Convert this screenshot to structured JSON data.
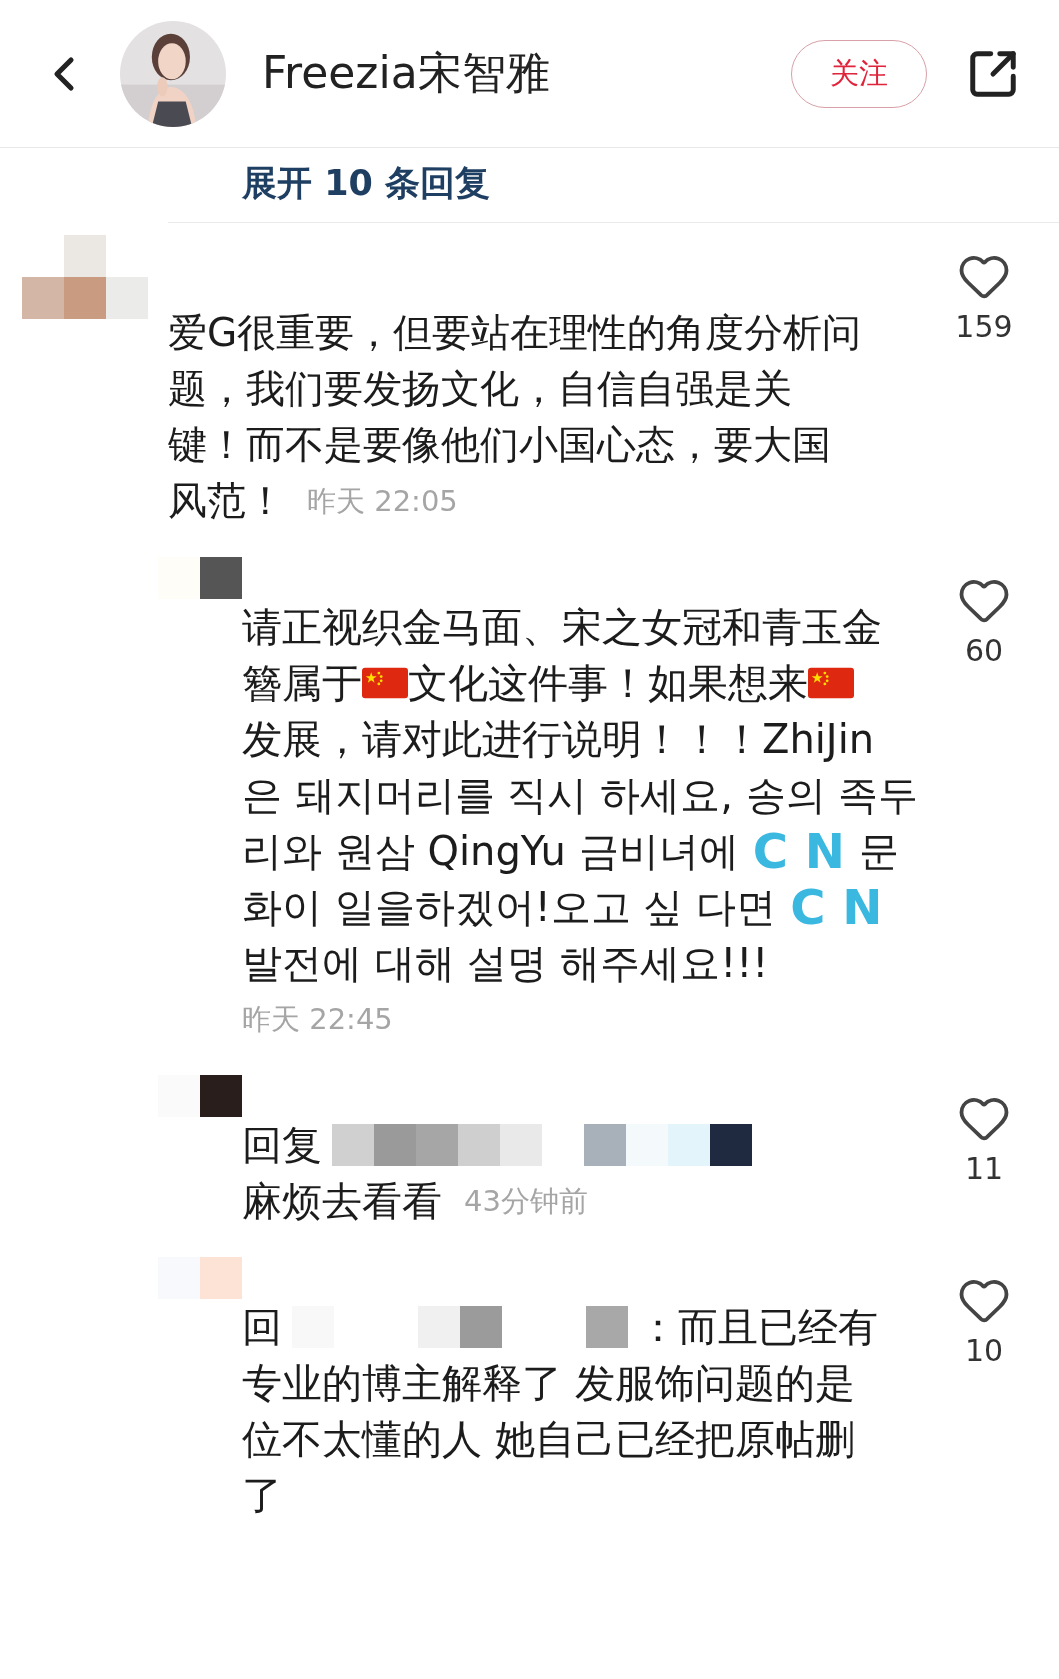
{
  "header": {
    "name": "Freezia宋智雅",
    "follow_button": "关注"
  },
  "expand_replies": "展开 10 条回复",
  "comments": [
    {
      "kind": "top",
      "likes": "159",
      "lines": [
        [
          {
            "kind": "text",
            "text": "爱G很重要，但要站在理性的角度分析问"
          }
        ],
        [
          {
            "kind": "text",
            "text": "题，我们要发扬文化，自信自强是关"
          }
        ],
        [
          {
            "kind": "text",
            "text": "键！而不是要像他们小国心态，要大国"
          }
        ],
        [
          {
            "kind": "text",
            "text": "风范！"
          },
          {
            "kind": "time",
            "text": "昨天 22:05"
          }
        ]
      ]
    },
    {
      "kind": "reply",
      "likes": "60",
      "lines": [
        [
          {
            "kind": "text",
            "text": "请正视织金马面、宋之女冠和青玉金"
          }
        ],
        [
          {
            "kind": "text",
            "text": "簪属于"
          },
          {
            "kind": "flag"
          },
          {
            "kind": "text",
            "text": "文化这件事！如果想来"
          },
          {
            "kind": "flag"
          }
        ],
        [
          {
            "kind": "text",
            "text": "发展，请对此进行说明！！！ZhiJin"
          }
        ],
        [
          {
            "kind": "text",
            "text": "은 돼지머리를 직시 하세요, 송의 족두"
          }
        ],
        [
          {
            "kind": "text",
            "text": "리와 원삼 QingYu 금비녀에"
          },
          {
            "kind": "letters",
            "text": "C N"
          },
          {
            "kind": "text",
            "text": "문"
          }
        ],
        [
          {
            "kind": "text",
            "text": "화이 일을하겠어!오고 싶 다면"
          },
          {
            "kind": "letters",
            "text": "C N"
          }
        ],
        [
          {
            "kind": "text",
            "text": "발전에 대해 설명 해주세요!!!"
          }
        ],
        [
          {
            "kind": "time",
            "text": "昨天 22:45"
          }
        ]
      ]
    },
    {
      "kind": "reply",
      "likes": "11",
      "lines": [
        [
          {
            "kind": "text",
            "text": "回复"
          },
          {
            "kind": "mosaic"
          }
        ],
        [
          {
            "kind": "text",
            "text": "麻烦去看看"
          },
          {
            "kind": "time",
            "text": "43分钟前"
          }
        ]
      ]
    },
    {
      "kind": "reply",
      "likes": "10",
      "lines": [
        [
          {
            "kind": "text",
            "text": "回"
          },
          {
            "kind": "mosaic"
          },
          {
            "kind": "text",
            "text": "：而且已经有"
          }
        ],
        [
          {
            "kind": "text",
            "text": "专业的博主解释了 发服饰问题的是"
          }
        ],
        [
          {
            "kind": "text",
            "text": "位不太懂的人 她自己已经把原帖删"
          }
        ],
        [
          {
            "kind": "text",
            "text": "了"
          }
        ]
      ]
    }
  ]
}
